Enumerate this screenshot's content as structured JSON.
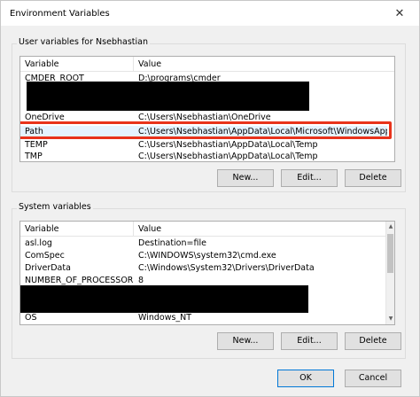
{
  "window": {
    "title": "Environment Variables",
    "close_glyph": "✕"
  },
  "user_vars": {
    "group_label": "User variables for Nsebhastian",
    "columns": [
      "Variable",
      "Value"
    ],
    "rows": [
      {
        "variable": "CMDER_ROOT",
        "value": "D:\\programs\\cmder"
      },
      {
        "variable": "",
        "value": ""
      },
      {
        "variable": "",
        "value": ""
      },
      {
        "variable": "OneDrive",
        "value": "C:\\Users\\Nsebhastian\\OneDrive"
      },
      {
        "variable": "Path",
        "value": "C:\\Users\\Nsebhastian\\AppData\\Local\\Microsoft\\WindowsApps;C:\\..."
      },
      {
        "variable": "TEMP",
        "value": "C:\\Users\\Nsebhastian\\AppData\\Local\\Temp"
      },
      {
        "variable": "TMP",
        "value": "C:\\Users\\Nsebhastian\\AppData\\Local\\Temp"
      }
    ],
    "buttons": {
      "new": "New...",
      "edit": "Edit...",
      "delete": "Delete"
    }
  },
  "system_vars": {
    "group_label": "System variables",
    "columns": [
      "Variable",
      "Value"
    ],
    "rows": [
      {
        "variable": "asl.log",
        "value": "Destination=file"
      },
      {
        "variable": "ComSpec",
        "value": "C:\\WINDOWS\\system32\\cmd.exe"
      },
      {
        "variable": "DriverData",
        "value": "C:\\Windows\\System32\\Drivers\\DriverData"
      },
      {
        "variable": "NUMBER_OF_PROCESSORS",
        "value": "8"
      },
      {
        "variable": "",
        "value": ""
      },
      {
        "variable": "",
        "value": ""
      },
      {
        "variable": "OS",
        "value": "Windows_NT"
      }
    ],
    "buttons": {
      "new": "New...",
      "edit": "Edit...",
      "delete": "Delete"
    }
  },
  "footer": {
    "ok": "OK",
    "cancel": "Cancel"
  },
  "colors": {
    "highlight": "#e8331b",
    "selected_row": "#e5f3ff",
    "redaction": "#000000"
  }
}
